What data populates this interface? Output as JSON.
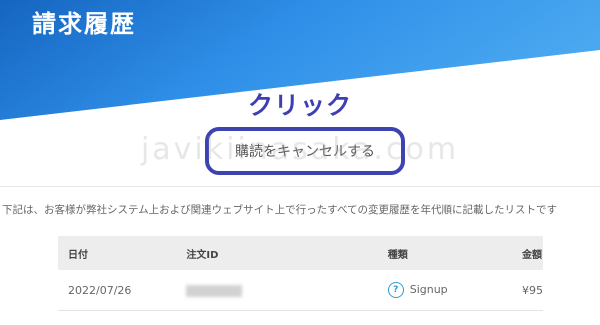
{
  "header": {
    "title": "請求履歴"
  },
  "annotation": {
    "text": "クリック"
  },
  "watermark": {
    "text": "javikiinasaka.com"
  },
  "actions": {
    "cancel_label": "購読をキャンセルする"
  },
  "description": "下記は、お客様が弊社システム上および関連ウェブサイト上で行ったすべての変更履歴を年代順に記載したリストです",
  "table": {
    "headers": {
      "date": "日付",
      "order_id": "注文ID",
      "type": "種類",
      "amount": "金額"
    },
    "rows": [
      {
        "date": "2022/07/26",
        "type": "Signup",
        "amount": "¥95"
      }
    ]
  },
  "colors": {
    "header_gradient": [
      "#1565c0",
      "#2f8fe8",
      "#4aa8f0"
    ],
    "accent": "#3e43b2",
    "help_icon": "#3399cc"
  },
  "icons": {
    "type_help": "question-circle-icon"
  }
}
